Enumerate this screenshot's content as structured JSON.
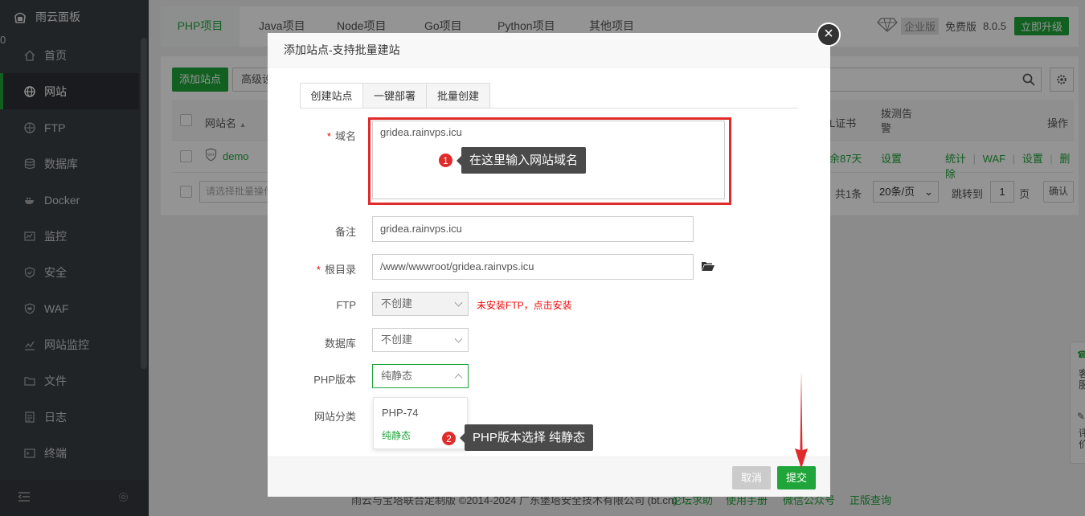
{
  "sidebar": {
    "brand": "雨云面板",
    "badge": "0",
    "items": [
      {
        "label": "首页",
        "icon": "home-icon"
      },
      {
        "label": "网站",
        "icon": "globe-icon",
        "active": true
      },
      {
        "label": "FTP",
        "icon": "ftp-icon"
      },
      {
        "label": "数据库",
        "icon": "database-icon"
      },
      {
        "label": "Docker",
        "icon": "docker-icon"
      },
      {
        "label": "监控",
        "icon": "monitor-icon"
      },
      {
        "label": "安全",
        "icon": "shield-icon"
      },
      {
        "label": "WAF",
        "icon": "waf-icon"
      },
      {
        "label": "网站监控",
        "icon": "chart-icon"
      },
      {
        "label": "文件",
        "icon": "folder-icon"
      },
      {
        "label": "日志",
        "icon": "log-icon"
      },
      {
        "label": "终端",
        "icon": "terminal-icon"
      }
    ]
  },
  "header": {
    "tabs": [
      "PHP项目",
      "Java项目",
      "Node项目",
      "Go项目",
      "Python项目",
      "其他项目"
    ],
    "edition": "企业版",
    "free": "免费版",
    "version": "8.0.5",
    "upgrade": "立即升级"
  },
  "panel": {
    "add_site": "添加站点",
    "advanced": "高级设",
    "col_name": "网站名",
    "col_ssl": "L证书",
    "col_probe": "拨测告警",
    "col_ops": "操作",
    "row": {
      "name": "demo",
      "ssl": "余87天",
      "probe": "设置",
      "ops": [
        "统计",
        "WAF",
        "设置",
        "删除"
      ]
    },
    "batch_placeholder": "请选择批量操作",
    "total": "共1条",
    "page_size": "20条/页",
    "goto": "跳转到",
    "page": "1",
    "page_unit": "页",
    "confirm": "确认"
  },
  "footer": {
    "copyright": "雨云与宝塔联合定制版 ©2014-2024 广东堡塔安全技术有限公司 (bt.cn)",
    "links": [
      "论坛求助",
      "使用手册",
      "微信公众号",
      "正版查询"
    ]
  },
  "modal": {
    "title": "添加站点-支持批量建站",
    "tabs": [
      "创建站点",
      "一键部署",
      "批量创建"
    ],
    "domain_label": "域名",
    "domain_value": "gridea.rainvps.icu",
    "remark_label": "备注",
    "remark_value": "gridea.rainvps.icu",
    "root_label": "根目录",
    "root_value": "/www/wwwroot/gridea.rainvps.icu",
    "ftp_label": "FTP",
    "ftp_value": "不创建",
    "ftp_warn": "未安装FTP，点击安装",
    "db_label": "数据库",
    "db_value": "不创建",
    "php_label": "PHP版本",
    "php_value": "纯静态",
    "php_options": [
      "PHP-74",
      "纯静态"
    ],
    "category_label": "网站分类",
    "cancel": "取消",
    "submit": "提交"
  },
  "annotations": {
    "tip1_num": "1",
    "tip1_text": "在这里输入网站域名",
    "tip2_num": "2",
    "tip2_text": "PHP版本选择 纯静态"
  },
  "float_panel": {
    "items": [
      "客服",
      "评价"
    ]
  },
  "colors": {
    "brand_green": "#20a53a",
    "sidebar_bg": "#3a3e44",
    "annotation_red": "#e02b2b",
    "badge_orange": "#e0622d"
  }
}
